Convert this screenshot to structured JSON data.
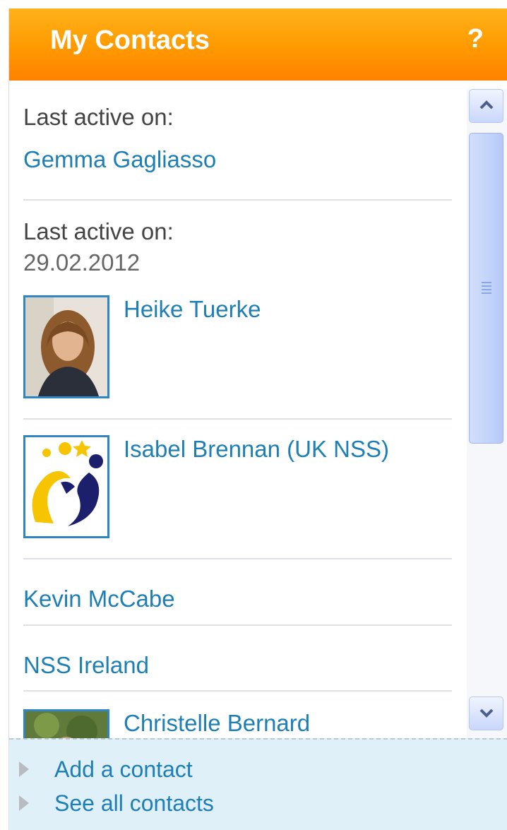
{
  "header": {
    "title": "My Contacts",
    "help_label": "?"
  },
  "contacts": [
    {
      "last_active_label": "Last active on:",
      "name": "Gemma Gagliasso"
    },
    {
      "last_active_label": "Last active on:",
      "last_active_date": "29.02.2012",
      "name": "Heike Tuerke"
    },
    {
      "name": "Isabel Brennan (UK NSS)"
    },
    {
      "name": "Kevin McCabe"
    },
    {
      "name": "NSS Ireland"
    },
    {
      "name": "Christelle Bernard"
    }
  ],
  "footer": {
    "add_contact": "Add a contact",
    "see_all": "See all contacts"
  },
  "colors": {
    "header_orange": "#ff9900",
    "link_blue": "#1d7fb6",
    "footer_bg": "#dff0f8"
  }
}
